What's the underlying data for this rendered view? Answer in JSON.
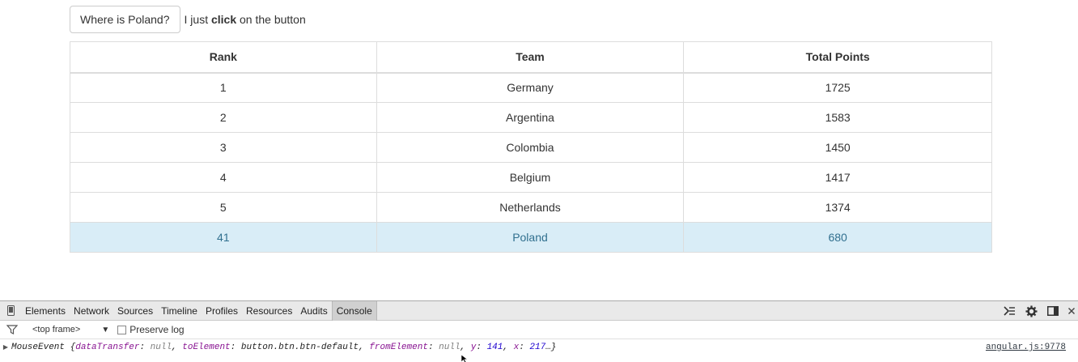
{
  "page": {
    "button_label": "Where is Poland?",
    "hint_prefix": "I just",
    "hint_bold": "click",
    "hint_suffix": "on the button"
  },
  "table": {
    "headers": [
      "Rank",
      "Team",
      "Total Points"
    ],
    "rows": [
      [
        "1",
        "Germany",
        "1725"
      ],
      [
        "2",
        "Argentina",
        "1583"
      ],
      [
        "3",
        "Colombia",
        "1450"
      ],
      [
        "4",
        "Belgium",
        "1417"
      ],
      [
        "5",
        "Netherlands",
        "1374"
      ],
      [
        "41",
        "Poland",
        "680"
      ]
    ],
    "highlighted_row": "Poland",
    "highlight_color": "#d9edf7"
  },
  "devtools": {
    "tabs": [
      "Elements",
      "Network",
      "Sources",
      "Timeline",
      "Profiles",
      "Resources",
      "Audits",
      "Console"
    ],
    "active_tab": "Console",
    "frame_select": "<top frame>",
    "preserve_log_label": "Preserve log",
    "log": {
      "prefix": "MouseEvent {",
      "k1": "dataTransfer",
      "v1": "null",
      "k2": "toElement",
      "v2": "button.btn.btn-default",
      "k3": "fromElement",
      "v3": "null",
      "k4": "y",
      "v4": "141",
      "k5": "x",
      "v5": "217",
      "suffix": "…}",
      "source": "angular.js:9778"
    },
    "icons": [
      "device-mode-icon",
      "console-drawer-icon",
      "settings-gear-icon",
      "dock-icon",
      "close-icon",
      "filter-icon"
    ]
  }
}
